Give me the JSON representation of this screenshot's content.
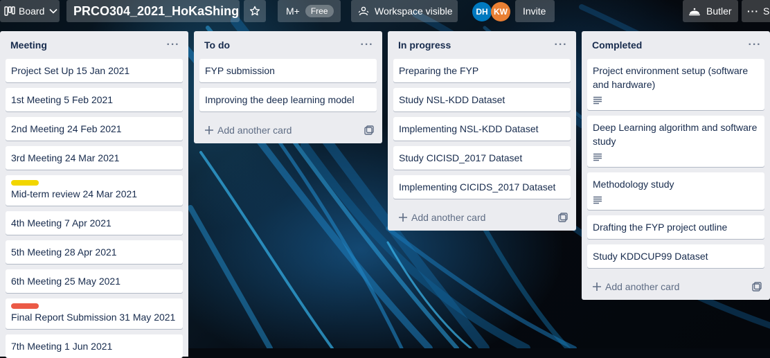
{
  "header": {
    "board_switcher_label": "Board",
    "board_title": "PRCO304_2021_HoKaShing",
    "powerups_label": "M+",
    "powerups_badge": "Free",
    "visibility_label": "Workspace visible",
    "members": [
      {
        "initials": "DH",
        "color": "#0079bf"
      },
      {
        "initials": "KW",
        "color": "#e97f33"
      }
    ],
    "invite_label": "Invite",
    "butler_label": "Butler",
    "show_menu_label": "S"
  },
  "lists": [
    {
      "title": "Meeting",
      "cards": [
        {
          "title": "Project Set Up 15 Jan 2021"
        },
        {
          "title": "1st Meeting 5 Feb 2021"
        },
        {
          "title": "2nd Meeting 24 Feb 2021"
        },
        {
          "title": "3rd Meeting 24 Mar 2021"
        },
        {
          "title": "Mid-term review 24 Mar 2021",
          "label_color": "#f2d600"
        },
        {
          "title": "4th Meeting 7 Apr 2021"
        },
        {
          "title": "5th Meeting 28 Apr 2021"
        },
        {
          "title": "6th Meeting 25 May 2021"
        },
        {
          "title": "Final Report Submission 31 May 2021",
          "label_color": "#eb5a46"
        },
        {
          "title": "7th Meeting 1 Jun 2021"
        }
      ]
    },
    {
      "title": "To do",
      "cards": [
        {
          "title": "FYP submission"
        },
        {
          "title": "Improving the deep learning model"
        }
      ],
      "add_card_label": "Add another card"
    },
    {
      "title": "In progress",
      "cards": [
        {
          "title": "Preparing the FYP"
        },
        {
          "title": "Study NSL-KDD Dataset"
        },
        {
          "title": "Implementing NSL-KDD Dataset"
        },
        {
          "title": "Study CICISD_2017 Dataset"
        },
        {
          "title": "Implementing CICIDS_2017 Dataset"
        }
      ],
      "add_card_label": "Add another card"
    },
    {
      "title": "Completed",
      "cards": [
        {
          "title": "Project environment setup (software and hardware)",
          "has_description": true
        },
        {
          "title": "Deep Learning algorithm and software study",
          "has_description": true
        },
        {
          "title": "Methodology study",
          "has_description": true
        },
        {
          "title": "Drafting the FYP project outline"
        },
        {
          "title": "Study KDDCUP99 Dataset"
        }
      ],
      "add_card_label": "Add another card"
    }
  ]
}
